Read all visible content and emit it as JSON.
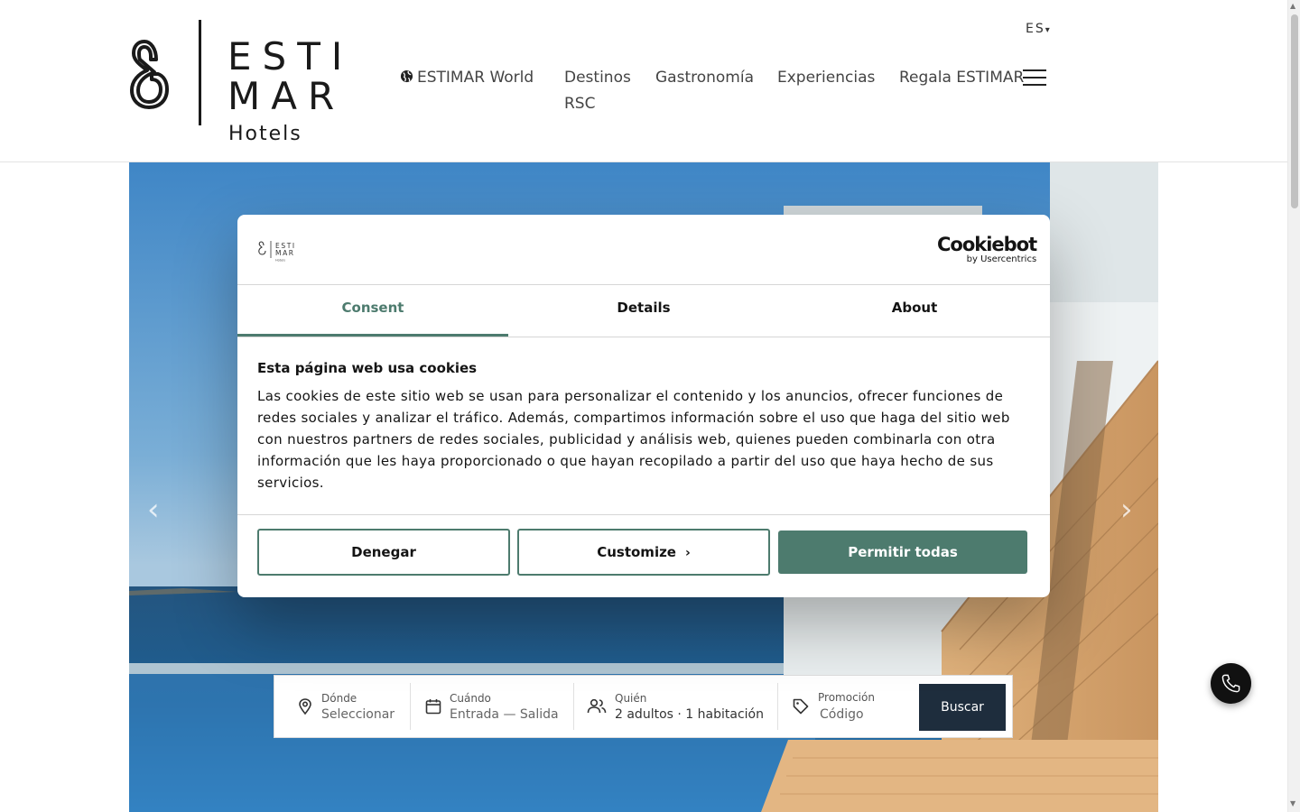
{
  "header": {
    "logo": {
      "word_line1": "ESTI",
      "word_line2": "MAR",
      "subtitle": "Hotels"
    },
    "language": {
      "code": "ES",
      "caret": "▾"
    },
    "nav": [
      {
        "label": "ESTIMAR World",
        "icon": "globe-icon"
      },
      {
        "label": "Destinos"
      },
      {
        "label": "Gastronomía"
      },
      {
        "label": "Experiencias"
      },
      {
        "label": "Regala ESTIMAR"
      },
      {
        "label": "RSC"
      }
    ],
    "menu_icon": "hamburger-icon"
  },
  "hero": {
    "prev_arrow": "‹",
    "next_arrow": "›"
  },
  "booking": {
    "where": {
      "label": "Dónde",
      "value": "Seleccionar",
      "icon": "location-pin-icon"
    },
    "when": {
      "label": "Cuándo",
      "value": "Entrada — Salida",
      "icon": "calendar-icon"
    },
    "who": {
      "label": "Quién",
      "value": "2 adultos · 1 habitación",
      "icon": "people-icon"
    },
    "promo": {
      "label": "Promoción",
      "placeholder": "Código",
      "icon": "tag-icon"
    },
    "search_label": "Buscar"
  },
  "cookie_dialog": {
    "brand_main": "Cookiebot",
    "brand_sub": "by Usercentrics",
    "logo_text": {
      "line1": "ESTI",
      "line2": "MAR",
      "sub": "Hotels"
    },
    "tabs": [
      {
        "label": "Consent",
        "active": true
      },
      {
        "label": "Details",
        "active": false
      },
      {
        "label": "About",
        "active": false
      }
    ],
    "heading": "Esta página web usa cookies",
    "body": "Las cookies de este sitio web se usan para personalizar el contenido y los anuncios, ofrecer funciones de redes sociales y analizar el tráfico. Además, compartimos información sobre el uso que haga del sitio web con nuestros partners de redes sociales, publicidad y análisis web, quienes pueden combinarla con otra información que les haya proporcionado o que hayan recopilado a partir del uso que haya hecho de sus servicios.",
    "buttons": {
      "deny": "Denegar",
      "customize": "Customize",
      "allow_all": "Permitir todas"
    }
  },
  "colors": {
    "accent": "#4d7b6e",
    "search_button": "#1e2d3d",
    "text": "#141414"
  }
}
